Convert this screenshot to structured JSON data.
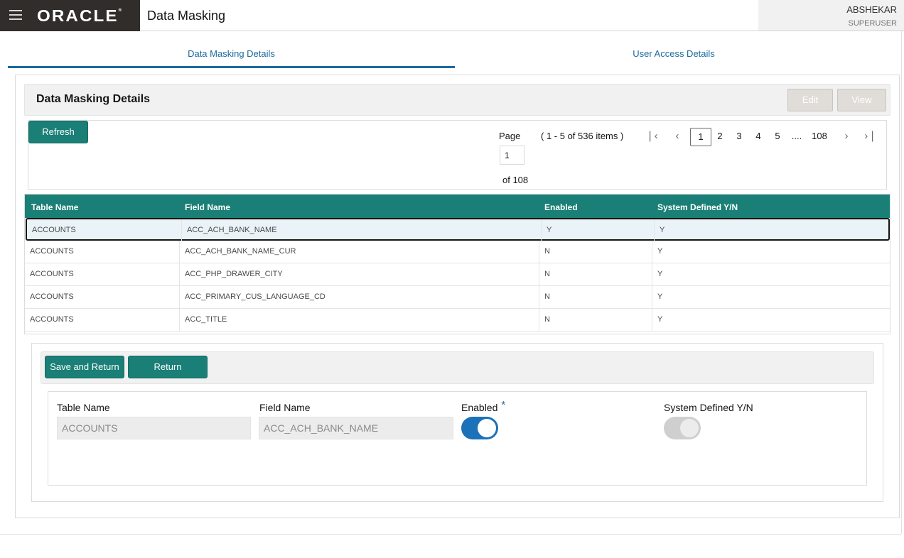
{
  "header": {
    "brand": "ORACLE",
    "app_title": "Data Masking",
    "user_name": "ABSHEKAR",
    "user_role": "SUPERUSER"
  },
  "tabs": [
    {
      "label": "Data Masking Details",
      "active": true
    },
    {
      "label": "User Access Details",
      "active": false
    }
  ],
  "section": {
    "title": "Data Masking Details",
    "edit_label": "Edit",
    "view_label": "View"
  },
  "toolbar": {
    "refresh_label": "Refresh"
  },
  "pagination": {
    "page_label": "Page",
    "page_value": "1",
    "of_label": "of 108",
    "items_summary": "( 1 - 5 of 536 items )",
    "pages": [
      "1",
      "2",
      "3",
      "4",
      "5",
      "....",
      "108"
    ],
    "current_page": "1"
  },
  "table": {
    "columns": [
      "Table Name",
      "Field Name",
      "Enabled",
      "System Defined Y/N"
    ],
    "rows": [
      [
        "ACCOUNTS",
        "ACC_ACH_BANK_NAME",
        "Y",
        "Y"
      ],
      [
        "ACCOUNTS",
        "ACC_ACH_BANK_NAME_CUR",
        "N",
        "Y"
      ],
      [
        "ACCOUNTS",
        "ACC_PHP_DRAWER_CITY",
        "N",
        "Y"
      ],
      [
        "ACCOUNTS",
        "ACC_PRIMARY_CUS_LANGUAGE_CD",
        "N",
        "Y"
      ],
      [
        "ACCOUNTS",
        "ACC_TITLE",
        "N",
        "Y"
      ]
    ],
    "selected_row": 0
  },
  "form": {
    "save_label": "Save and Return",
    "return_label": "Return",
    "table_name_label": "Table Name",
    "table_name_value": "ACCOUNTS",
    "field_name_label": "Field Name",
    "field_name_value": "ACC_ACH_BANK_NAME",
    "enabled_label": "Enabled",
    "required_mark": "*",
    "enabled_on": true,
    "system_defined_label": "System Defined Y/N",
    "system_defined_on": true
  },
  "colors": {
    "teal": "#1a7f76",
    "blue_accent": "#1b6a9e",
    "toggle_blue": "#1b72b8",
    "header_dark": "#312d2a"
  }
}
